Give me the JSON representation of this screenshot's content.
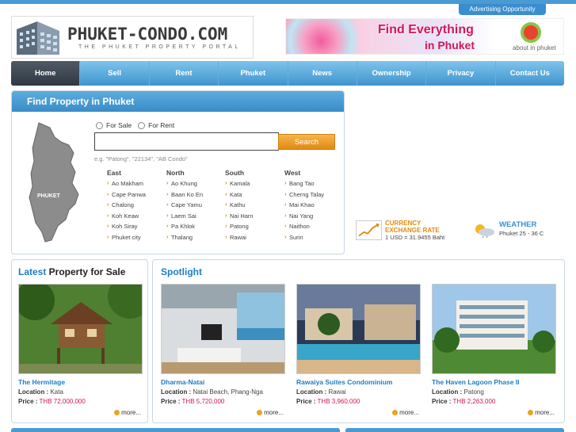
{
  "header": {
    "advertising_link": "Advertising Opportunity",
    "logo_title": "PHUKET-CONDO.COM",
    "logo_subtitle": "THE PHUKET PROPERTY PORTAL",
    "banner_line1": "Find Everything",
    "banner_line2": "in Phuket",
    "banner_brand": "about in phuket"
  },
  "nav": {
    "items": [
      "Home",
      "Sell",
      "Rent",
      "Phuket",
      "News",
      "Ownership",
      "Privacy",
      "Contact Us"
    ],
    "active": "Home"
  },
  "find": {
    "title": "Find Property in Phuket",
    "map_label": "PHUKET",
    "radio_sale": "For Sale",
    "radio_rent": "For Rent",
    "search_value": "",
    "search_button": "Search",
    "hint": "e.g. \"Patong\", \"22134\", \"AB Condo\"",
    "columns": [
      {
        "heading": "East",
        "items": [
          "Ao Makham",
          "Cape Panwa",
          "Chalong",
          "Koh Keaw",
          "Koh Siray",
          "Phuket city"
        ]
      },
      {
        "heading": "North",
        "items": [
          "Ao Khung",
          "Baan Ko En",
          "Cape Yamu",
          "Laem Sai",
          "Pa Khlok",
          "Thalang"
        ]
      },
      {
        "heading": "South",
        "items": [
          "Kamala",
          "Kata",
          "Kathu",
          "Nai Harn",
          "Patong",
          "Rawai"
        ]
      },
      {
        "heading": "West",
        "items": [
          "Bang Tao",
          "Cherng Talay",
          "Mai Khao",
          "Nai Yang",
          "Naithon",
          "Surin"
        ]
      }
    ]
  },
  "widgets": {
    "currency_title_1": "CURRENCY",
    "currency_title_2": "EXCHANGE RATE",
    "currency_value": "1 USD = 31.9455 Baht",
    "weather_title": "WEATHER",
    "weather_value": "Phuket 25 - 36 C"
  },
  "latest": {
    "title_a": "Latest",
    "title_b": " Property for Sale",
    "card": {
      "name": "The Hermitage",
      "location_label": "Location :",
      "location": "Kata",
      "price_label": "Price :",
      "price": "THB 72,000,000",
      "more": "more..."
    }
  },
  "spotlight": {
    "title": "Spotlight",
    "cards": [
      {
        "name": "Dharma-Natai",
        "location_label": "Location :",
        "location": "Natai Beach, Phang-Nga",
        "price_label": "Price :",
        "price": "THB 5,720,000",
        "more": "more..."
      },
      {
        "name": "Rawaiya Suites Condominium",
        "location_label": "Location :",
        "location": "Rawai",
        "price_label": "Price :",
        "price": "THB 3,960,000",
        "more": "more..."
      },
      {
        "name": "The Haven Lagoon Phase II",
        "location_label": "Location :",
        "location": "Patong",
        "price_label": "Price :",
        "price": "THB 2,263,000",
        "more": "more..."
      }
    ]
  }
}
